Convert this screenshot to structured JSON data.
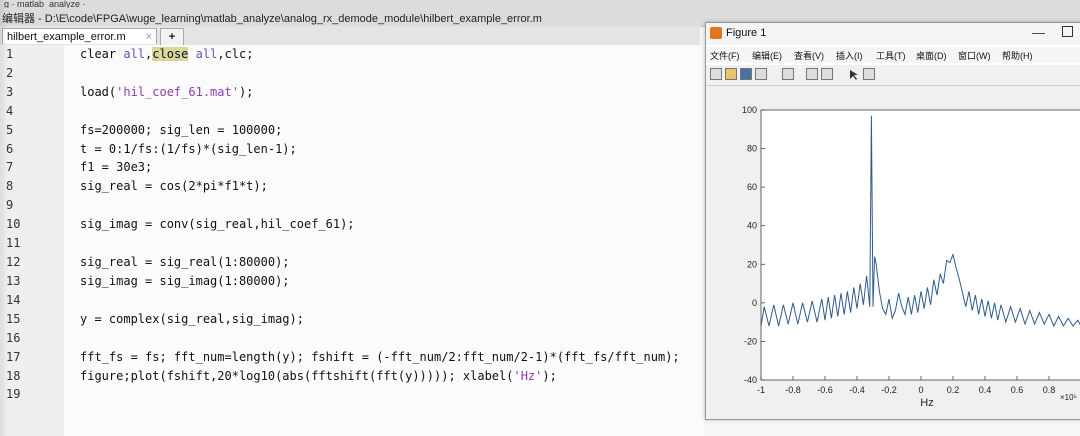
{
  "window": {
    "menu_strip": "g · matlab_analyze ·",
    "title": "编辑器 - D:\\E\\code\\FPGA\\wuge_learning\\matlab_analyze\\analog_rx_demode_module\\hilbert_example_error.m"
  },
  "tabs": {
    "active_label": "hilbert_example_error.m",
    "close_glyph": "×",
    "add_glyph": "+"
  },
  "editor": {
    "line_numbers": [
      "1",
      "2",
      "3",
      "4",
      "5",
      "6",
      "7",
      "8",
      "9",
      "10",
      "11",
      "12",
      "13",
      "14",
      "15",
      "16",
      "17",
      "18",
      "19"
    ],
    "lines": {
      "l1_a": "clear ",
      "l1_b": "all",
      "l1_c": ",",
      "l1_d": "close",
      "l1_e": " ",
      "l1_f": "all",
      "l1_g": ",clc;",
      "l3_a": "load(",
      "l3_b": "'hil_coef_61.mat'",
      "l3_c": ");",
      "l5": "fs=200000; sig_len = 100000;",
      "l6": "t = 0:1/fs:(1/fs)*(sig_len-1);",
      "l7": "f1 = 30e3;",
      "l8": "sig_real = cos(2*pi*f1*t);",
      "l10": "sig_imag = conv(sig_real,hil_coef_61);",
      "l12": "sig_real = sig_real(1:80000);",
      "l13": "sig_imag = sig_imag(1:80000);",
      "l15": "y = complex(sig_real,sig_imag);",
      "l17": "fft_fs = fs; fft_num=length(y); fshift = (-fft_num/2:fft_num/2-1)*(fft_fs/fft_num);",
      "l18_a": "figure;plot(fshift,20*log10(abs(fftshift(fft(y))))); xlabel(",
      "l18_b": "'Hz'",
      "l18_c": ");"
    }
  },
  "figure": {
    "title": "Figure 1",
    "minimize_glyph": "—",
    "menu": [
      "文件(F)",
      "编辑(E)",
      "查看(V)",
      "插入(I)",
      "工具(T)",
      "桌面(D)",
      "窗口(W)",
      "帮助(H)"
    ],
    "toolbar_icons": [
      "new-figure-icon",
      "open-icon",
      "save-icon",
      "print-icon",
      "link-icon",
      "insert-colorbar-icon",
      "insert-legend-icon",
      "pointer-icon",
      "property-editor-icon"
    ],
    "line_color": "#2f5c8f"
  },
  "chart_data": {
    "type": "line",
    "title": "",
    "xlabel": "Hz",
    "ylabel": "",
    "x_exponent_label": "×10⁵",
    "xlim": [
      -1,
      1
    ],
    "ylim": [
      -40,
      100
    ],
    "xticks": [
      "-1",
      "-0.8",
      "-0.6",
      "-0.4",
      "-0.2",
      "0",
      "0.2",
      "0.4",
      "0.6",
      "0.8"
    ],
    "yticks": [
      "100",
      "80",
      "60",
      "40",
      "20",
      "0",
      "-20",
      "-40"
    ],
    "series": [
      {
        "x": [
          -1.0,
          -0.98,
          -0.95,
          -0.92,
          -0.89,
          -0.86,
          -0.83,
          -0.8,
          -0.77,
          -0.74,
          -0.71,
          -0.68,
          -0.65,
          -0.62,
          -0.6,
          -0.58,
          -0.56,
          -0.54,
          -0.52,
          -0.5,
          -0.48,
          -0.46,
          -0.44,
          -0.42,
          -0.4,
          -0.38,
          -0.36,
          -0.34,
          -0.32,
          -0.31,
          -0.3,
          -0.29,
          -0.28,
          -0.26,
          -0.24,
          -0.22,
          -0.2,
          -0.18,
          -0.16,
          -0.14,
          -0.12,
          -0.1,
          -0.08,
          -0.06,
          -0.04,
          -0.02,
          0.0,
          0.02,
          0.04,
          0.06,
          0.08,
          0.1,
          0.12,
          0.14,
          0.16,
          0.18,
          0.2,
          0.22,
          0.24,
          0.26,
          0.28,
          0.3,
          0.32,
          0.34,
          0.36,
          0.38,
          0.4,
          0.42,
          0.44,
          0.46,
          0.48,
          0.5,
          0.53,
          0.56,
          0.59,
          0.62,
          0.65,
          0.68,
          0.71,
          0.74,
          0.77,
          0.8,
          0.83,
          0.86,
          0.89,
          0.92,
          0.95,
          0.98,
          1.0
        ],
        "y": [
          -12,
          -2,
          -12,
          -1,
          -12,
          -1,
          -11,
          0,
          -11,
          0,
          -10,
          1,
          -10,
          2,
          -9,
          3,
          -8,
          4,
          -7,
          5,
          -6,
          6,
          -5,
          8,
          -3,
          10,
          -1,
          14,
          -2,
          97,
          -2,
          24,
          20,
          6,
          -3,
          -6,
          2,
          -8,
          -4,
          5,
          -2,
          -6,
          3,
          -6,
          4,
          -5,
          6,
          -3,
          8,
          -1,
          12,
          4,
          15,
          10,
          22,
          21,
          25,
          18,
          12,
          5,
          -2,
          6,
          -4,
          4,
          -6,
          2,
          -7,
          1,
          -8,
          0,
          -9,
          -1,
          -10,
          -2,
          -10,
          -3,
          -11,
          -4,
          -11,
          -5,
          -11,
          -6,
          -12,
          -7,
          -12,
          -8,
          -12,
          -9,
          -12
        ]
      }
    ]
  }
}
